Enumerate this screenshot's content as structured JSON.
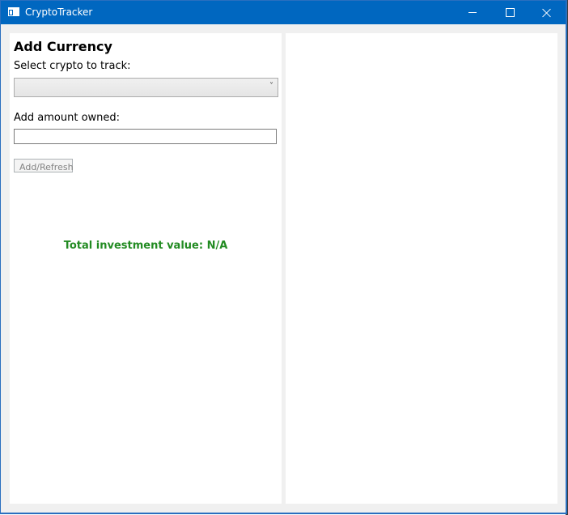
{
  "window": {
    "title": "CryptoTracker"
  },
  "titlebar": {
    "minimize_icon": "minimize-icon",
    "maximize_icon": "maximize-icon",
    "close_icon": "close-icon",
    "color": "#0067c0"
  },
  "add_currency": {
    "heading": "Add Currency",
    "select_label": "Select crypto to track:",
    "select_value": "",
    "amount_label": "Add amount owned:",
    "amount_value": "",
    "button_label": "Add/Refresh"
  },
  "summary": {
    "total_text": "Total investment value: N/A",
    "total_color": "#228b22"
  }
}
